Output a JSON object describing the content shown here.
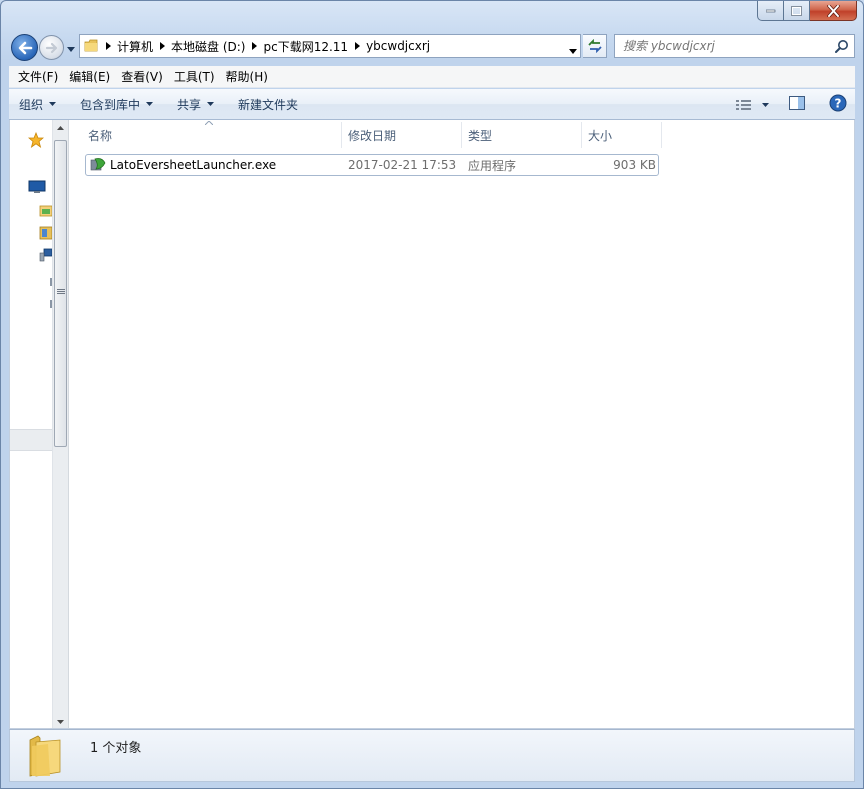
{
  "window": {
    "caption": {
      "minimize": "minimize",
      "maximize": "maximize",
      "close": "close"
    }
  },
  "address": {
    "crumbs": [
      "计算机",
      "本地磁盘 (D:)",
      "pc下载网12.11",
      "ybcwdjcxrj"
    ]
  },
  "search": {
    "placeholder": "搜索 ybcwdjcxrj"
  },
  "menu": {
    "items": [
      "文件(F)",
      "编辑(E)",
      "查看(V)",
      "工具(T)",
      "帮助(H)"
    ]
  },
  "commands": {
    "organize": "组织",
    "include_library": "包含到库中",
    "share": "共享",
    "new_folder": "新建文件夹"
  },
  "columns": {
    "name": "名称",
    "date": "修改日期",
    "type": "类型",
    "size": "大小"
  },
  "files": [
    {
      "name": "LatoEversheetLauncher.exe",
      "date": "2017-02-21 17:53",
      "type": "应用程序",
      "size": "903 KB"
    }
  ],
  "details": {
    "text": "1 个对象"
  },
  "colors": {
    "accent": "#2a67b9",
    "header_text": "#4c607a",
    "command_text": "#1e395b"
  }
}
